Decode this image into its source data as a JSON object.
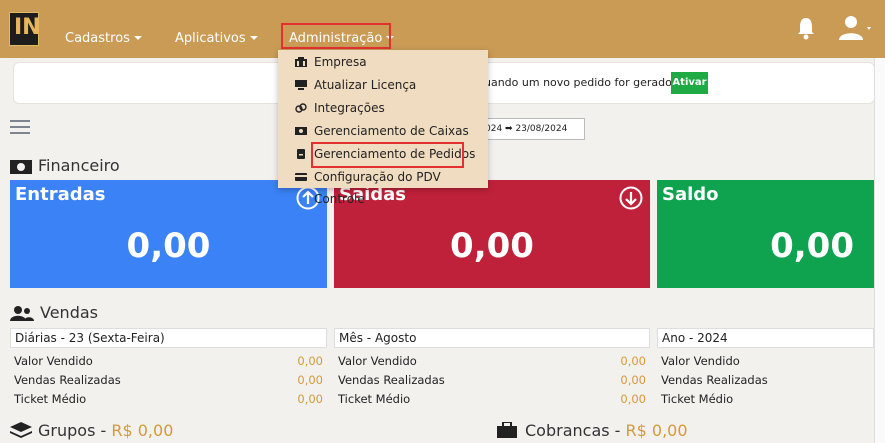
{
  "navbar": {
    "logo_text": "IN",
    "menu": [
      "Cadastros",
      "Aplicativos",
      "Administração"
    ],
    "bg_color": "#c99b55"
  },
  "notification": {
    "text": "uando um novo pedido for gerado",
    "button_label": "Ativar"
  },
  "date_range": "024 ➡ 23/08/2024",
  "dropdown": {
    "items": [
      {
        "icon": "building-icon",
        "label": "Empresa"
      },
      {
        "icon": "monitor-icon",
        "label": "Atualizar Licença"
      },
      {
        "icon": "link-icon",
        "label": "Integrações"
      },
      {
        "icon": "cash-register-icon",
        "label": "Gerenciamento de Caixas"
      },
      {
        "icon": "receipt-icon",
        "label": "Gerenciamento de Pedidos"
      },
      {
        "icon": "card-icon",
        "label": "Configuração do PDV Controle"
      }
    ]
  },
  "financeiro": {
    "title": "Financeiro",
    "cards": [
      {
        "title": "Entradas",
        "value": "0,00",
        "color": "#3b82f6"
      },
      {
        "title": "Saídas",
        "value": "0,00",
        "color": "#c0213a"
      },
      {
        "title": "Saldo",
        "value": "0,00",
        "color": "#0fa350"
      }
    ]
  },
  "vendas": {
    "title": "Vendas",
    "panels": [
      {
        "header": "Diárias - 23 (Sexta-Feira)",
        "rows": [
          {
            "label": "Valor Vendido",
            "value": "0,00"
          },
          {
            "label": "Vendas Realizadas",
            "value": "0,00"
          },
          {
            "label": "Ticket Médio",
            "value": "0,00"
          }
        ]
      },
      {
        "header": "Mês - Agosto",
        "rows": [
          {
            "label": "Valor Vendido",
            "value": "0,00"
          },
          {
            "label": "Vendas Realizadas",
            "value": "0,00"
          },
          {
            "label": "Ticket Médio",
            "value": "0,00"
          }
        ]
      },
      {
        "header": "Ano - 2024",
        "rows": [
          {
            "label": "Valor Vendido",
            "value": ""
          },
          {
            "label": "Vendas Realizadas",
            "value": ""
          },
          {
            "label": "Ticket Médio",
            "value": ""
          }
        ]
      }
    ]
  },
  "grupos": {
    "label": "Grupos -",
    "value": "R$ 0,00"
  },
  "cobrancas": {
    "label": "Cobrancas -",
    "value": "R$ 0,00"
  }
}
